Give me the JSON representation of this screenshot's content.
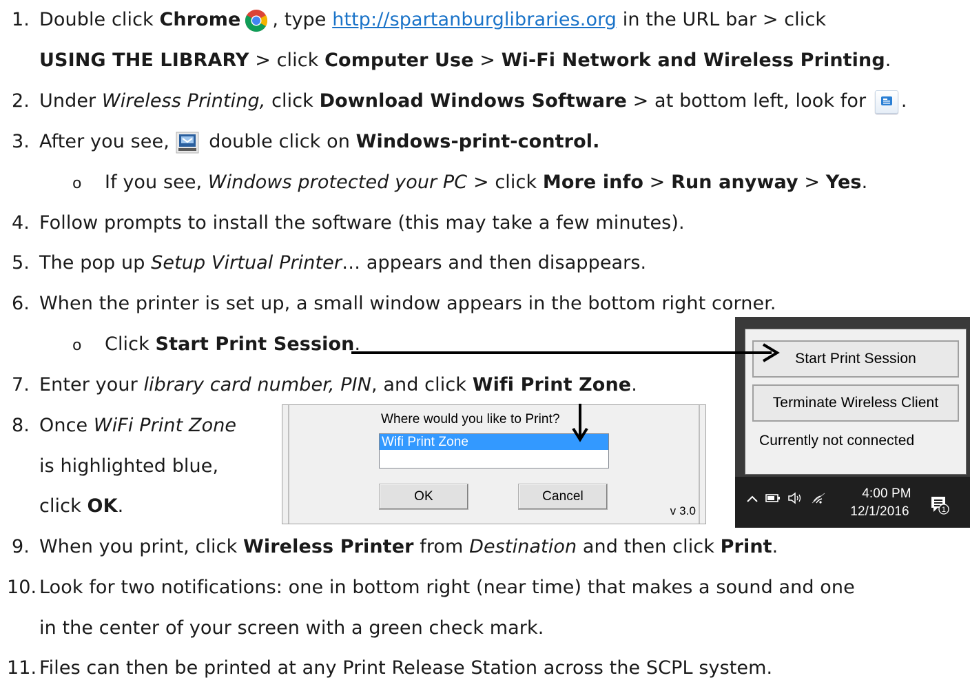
{
  "steps": {
    "s1": {
      "num": "1.",
      "a": "Double click ",
      "b_chrome": "Chrome",
      "c": ", type ",
      "link": "http://spartanburglibraries.org",
      "d": " in the URL bar > click",
      "e_using": "USING THE LIBRARY",
      "f": " > click ",
      "g_computer": "Computer Use",
      "h": " > ",
      "i_wifi": "Wi-Fi Network and Wireless Printing",
      "j": "."
    },
    "s2": {
      "num": "2.",
      "a": "Under ",
      "b_italic": "Wireless Printing,",
      "c": " click ",
      "d_bold": "Download Windows Software",
      "e": " > at bottom left, look for ",
      "f": "."
    },
    "s3": {
      "num": "3.",
      "a": "After you see, ",
      "b": " double click on ",
      "c_bold": "Windows-print-control.",
      "sub": {
        "bullet": "o",
        "a": "If you see, ",
        "b_italic": "Windows protected your PC",
        "c": " > click ",
        "d_more": "More info",
        "e": " > ",
        "f_run": "Run anyway",
        "g": " > ",
        "h_yes": "Yes",
        "i": "."
      }
    },
    "s4": {
      "num": "4.",
      "text": "Follow prompts to install the software (this may take a few minutes)."
    },
    "s5": {
      "num": "5.",
      "a": "The pop up ",
      "b_italic": "Setup Virtual Printer",
      "c": "… appears and then disappears."
    },
    "s6": {
      "num": "6.",
      "text": "When the printer is set up, a small window appears in the bottom right corner.",
      "sub": {
        "bullet": "o",
        "a": "Click ",
        "b_bold": "Start Print Session",
        "c": "."
      }
    },
    "s7": {
      "num": "7.",
      "a": "Enter your ",
      "b_italic": "library card number, PIN",
      "c": ", and click ",
      "d_bold": "Wifi Print Zone",
      "e": "."
    },
    "s8": {
      "num": "8.",
      "l1a": "Once ",
      "l1b_italic": "WiFi Print Zone",
      "l2": "is highlighted blue,",
      "l3a": "click ",
      "l3b_bold": "OK",
      "l3c": "."
    },
    "s9": {
      "num": "9.",
      "a": "When you print, click ",
      "b_bold": "Wireless Printer",
      "c": " from ",
      "d_italic": "Destination",
      "e": " and then click ",
      "f_bold": "Print",
      "g": "."
    },
    "s10": {
      "num": "10.",
      "l1": "Look for two notifications: one in bottom right (near time) that makes a sound and one",
      "l2": "in the center of your screen with a green check mark."
    },
    "s11": {
      "num": "11.",
      "text": "Files can then be printed at any Print Release Station across the SCPL system."
    }
  },
  "dialog": {
    "question": "Where would you like to Print?",
    "selected_item": "Wifi Print Zone",
    "ok_label": "OK",
    "cancel_label": "Cancel",
    "version": "v 3.0",
    "selection_color": "#3399ff"
  },
  "tray": {
    "start_label": "Start Print Session",
    "terminate_label": "Terminate Wireless Client",
    "status": "Currently not connected",
    "time": "4:00 PM",
    "date": "12/1/2016",
    "notification_count": "1"
  },
  "icons": [
    "chrome-icon",
    "download-bubble-icon",
    "installer-icon",
    "chevron-up-icon",
    "battery-icon",
    "volume-icon",
    "wifi-icon",
    "notification-icon"
  ],
  "colors": {
    "link": "#1a73c8",
    "text": "#1a1a1a"
  }
}
